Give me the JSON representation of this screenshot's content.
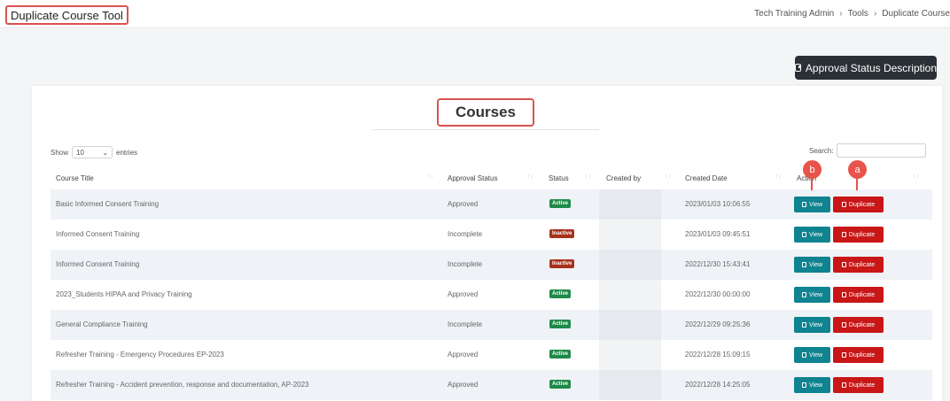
{
  "app": {
    "title": "Duplicate Course Tool"
  },
  "breadcrumb": {
    "items": [
      "Tech Training Admin",
      "Tools",
      "Duplicate Course"
    ]
  },
  "approval_button": {
    "label": "Approval Status Description"
  },
  "table_section": {
    "heading": "Courses",
    "show_label": "Show",
    "entries_value": "10",
    "entries_label": "entries",
    "search_label": "Search:",
    "search_value": ""
  },
  "columns": [
    "Course Title",
    "Approval Status",
    "Status",
    "Created by",
    "Created Date",
    "Action"
  ],
  "rows": [
    {
      "title": "Basic Informed Consent Training",
      "approval": "Approved",
      "status": "Active",
      "created_by": "",
      "date": "2023/01/03 10:06:55"
    },
    {
      "title": "Informed Consent Training",
      "approval": "Incomplete",
      "status": "Inactive",
      "created_by": "",
      "date": "2023/01/03 09:45:51"
    },
    {
      "title": "Informed Consent Training",
      "approval": "Incomplete",
      "status": "Inactive",
      "created_by": "",
      "date": "2022/12/30 15:43:41"
    },
    {
      "title": "2023_Students HIPAA and Privacy Training",
      "approval": "Approved",
      "status": "Active",
      "created_by": "",
      "date": "2022/12/30 00:00:00"
    },
    {
      "title": "General Compliance Training",
      "approval": "Incomplete",
      "status": "Active",
      "created_by": "",
      "date": "2022/12/29 09:25:36"
    },
    {
      "title": "Refresher Training - Emergency Procedures EP-2023",
      "approval": "Approved",
      "status": "Active",
      "created_by": "",
      "date": "2022/12/28 15:09:15"
    },
    {
      "title": "Refresher Training - Accident prevention, response and documentation, AP-2023",
      "approval": "Approved",
      "status": "Active",
      "created_by": "",
      "date": "2022/12/28 14:25:05"
    }
  ],
  "actions": {
    "view": "View",
    "duplicate": "Duplicate"
  },
  "markers": {
    "a": "a",
    "b": "b"
  },
  "colors": {
    "view": "#0f8390",
    "duplicate": "#c91617",
    "active": "#1f8a49",
    "inactive": "#a7321c",
    "marker": "#e8534b",
    "highlight": "#d9534f"
  }
}
